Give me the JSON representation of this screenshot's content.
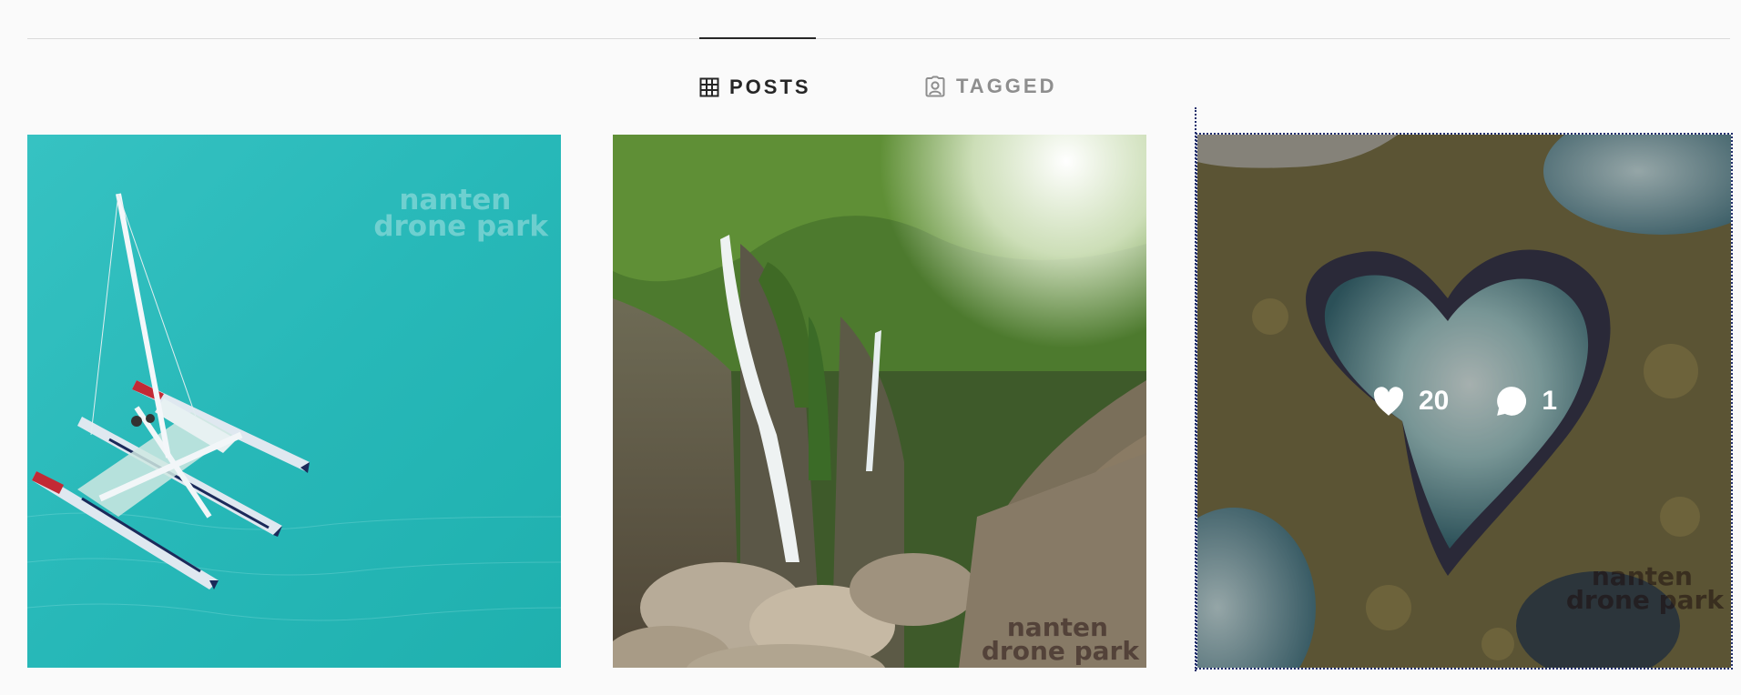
{
  "tabs": [
    {
      "label": "POSTS",
      "icon": "grid-icon",
      "active": true
    },
    {
      "label": "TAGGED",
      "icon": "tagged-user-icon",
      "active": false
    }
  ],
  "posts": [
    {
      "alt_subject": "catamaran",
      "watermark": [
        "nanten",
        "drone park"
      ]
    },
    {
      "alt_subject": "waterfall",
      "watermark": [
        "nanten",
        "drone park"
      ]
    },
    {
      "alt_subject": "heart-pool",
      "watermark": [
        "nanten",
        "drone park"
      ],
      "hover": {
        "likes": "20",
        "comments": "1"
      }
    }
  ],
  "colors": {
    "active_tab": "#262626",
    "inactive_tab": "#8e8e8e",
    "divider": "#dbdbdb",
    "background": "#fafafa"
  }
}
